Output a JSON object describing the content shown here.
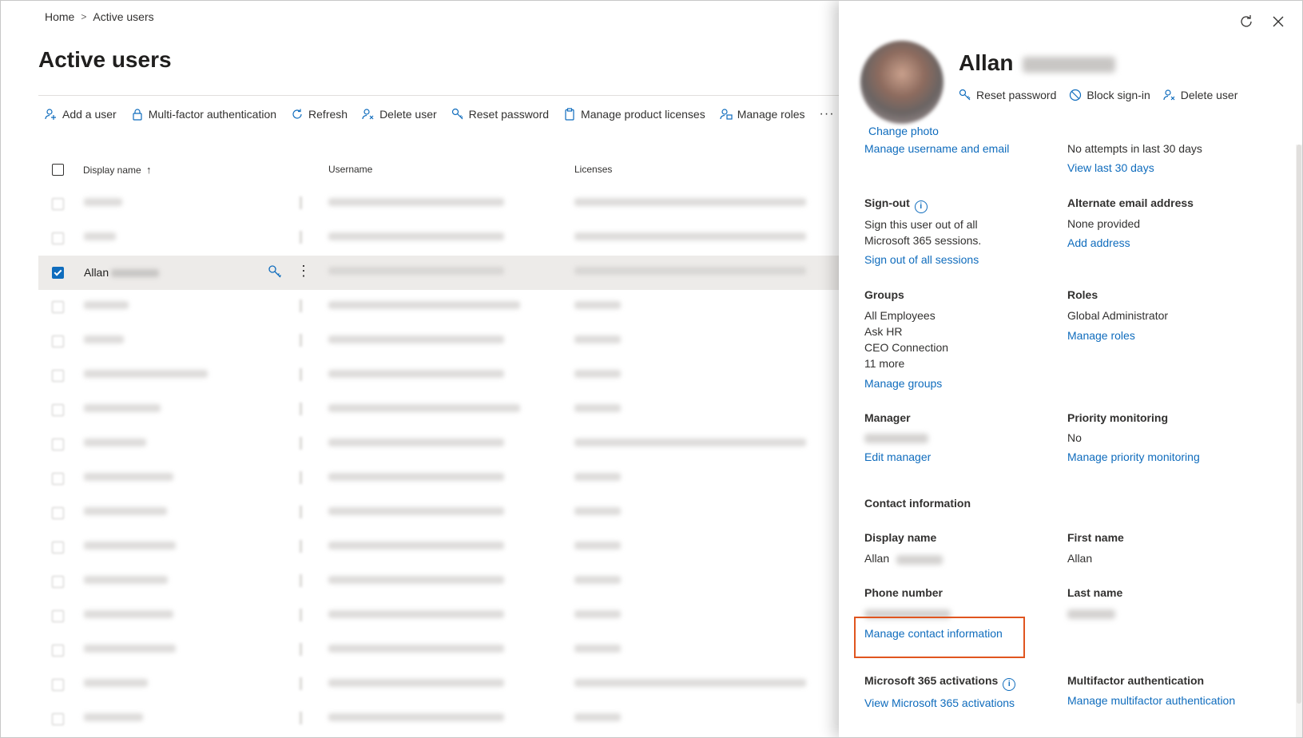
{
  "breadcrumb": {
    "home": "Home",
    "separator": ">",
    "current": "Active users"
  },
  "page": {
    "title": "Active users"
  },
  "toolbar": {
    "items": [
      {
        "label": "Add a user",
        "icon": "add-person-icon"
      },
      {
        "label": "Multi-factor authentication",
        "icon": "lock-icon"
      },
      {
        "label": "Refresh",
        "icon": "refresh-icon"
      },
      {
        "label": "Delete user",
        "icon": "delete-user-icon"
      },
      {
        "label": "Reset password",
        "icon": "key-icon"
      },
      {
        "label": "Manage product licenses",
        "icon": "clipboard-icon"
      },
      {
        "label": "Manage roles",
        "icon": "manage-roles-icon"
      }
    ],
    "more": "···"
  },
  "grid": {
    "columns": {
      "display_name": "Display name",
      "sort_indicator": "↑",
      "username": "Username",
      "licenses": "Licenses"
    },
    "selected_row": {
      "display_name": "Allan"
    },
    "more": "⋮"
  },
  "panel": {
    "user_name": "Allan",
    "change_photo": "Change photo",
    "actions": {
      "reset_password": "Reset password",
      "block_signin": "Block sign-in",
      "delete_user": "Delete user"
    },
    "username_section": {
      "link": "Manage username and email"
    },
    "signin_section": {
      "value": "No attempts in last 30 days",
      "link": "View last 30 days"
    },
    "signout": {
      "label": "Sign-out",
      "text_line1": "Sign this user out of all",
      "text_line2": "Microsoft 365 sessions.",
      "link": "Sign out of all sessions"
    },
    "alternate_email": {
      "label": "Alternate email address",
      "value": "None provided",
      "link": "Add address"
    },
    "groups": {
      "label": "Groups",
      "items": [
        "All Employees",
        "Ask HR",
        "CEO Connection",
        "11 more"
      ],
      "link": "Manage groups"
    },
    "roles": {
      "label": "Roles",
      "value": "Global Administrator",
      "link": "Manage roles"
    },
    "manager": {
      "label": "Manager",
      "link": "Edit manager"
    },
    "priority_monitoring": {
      "label": "Priority monitoring",
      "value": "No",
      "link": "Manage priority monitoring"
    },
    "contact_heading": "Contact information",
    "display_name": {
      "label": "Display name",
      "value": "Allan"
    },
    "first_name": {
      "label": "First name",
      "value": "Allan"
    },
    "phone_number": {
      "label": "Phone number"
    },
    "last_name": {
      "label": "Last name"
    },
    "manage_contact_link": "Manage contact information",
    "m365_activations": {
      "label": "Microsoft 365 activations",
      "link": "View Microsoft 365 activations"
    },
    "mfa": {
      "label": "Multifactor authentication",
      "link": "Manage multifactor authentication"
    },
    "info_glyph": "i"
  },
  "colors": {
    "accent": "#0f6cbd",
    "highlight": "#e0551f",
    "selected_row": "#edebe9"
  }
}
